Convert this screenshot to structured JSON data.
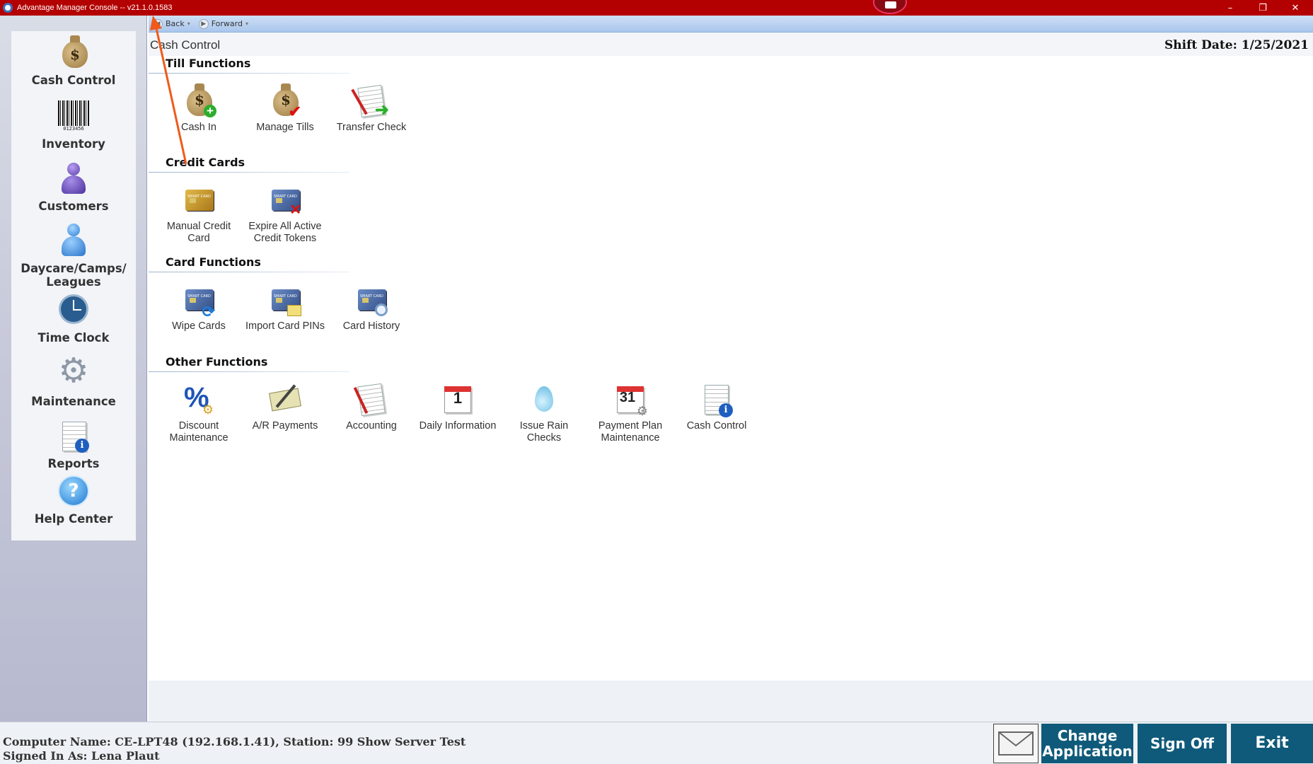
{
  "window": {
    "title": "Advantage Manager Console -- v21.1.0.1583",
    "controls": {
      "minimize": "–",
      "restore": "❐",
      "close": "✕"
    }
  },
  "navbar": {
    "back": "Back",
    "forward": "Forward"
  },
  "sidebar": {
    "items": [
      {
        "label": "Cash Control",
        "icon": "money-bag-icon"
      },
      {
        "label": "Inventory",
        "icon": "barcode-icon"
      },
      {
        "label": "Customers",
        "icon": "person-icon"
      },
      {
        "label": "Daycare/Camps/ Leagues",
        "icon": "person-blue-icon"
      },
      {
        "label": "Time Clock",
        "icon": "clock-icon"
      },
      {
        "label": "Maintenance",
        "icon": "gear-icon"
      },
      {
        "label": "Reports",
        "icon": "report-icon"
      },
      {
        "label": "Help Center",
        "icon": "help-icon"
      }
    ]
  },
  "main": {
    "page_title": "Cash Control",
    "shift_date": "Shift Date: 1/25/2021",
    "sections": [
      {
        "title": "Till Functions",
        "tiles": [
          {
            "label": "Cash In",
            "icon": "cash-in-icon"
          },
          {
            "label": "Manage Tills",
            "icon": "manage-tills-icon"
          },
          {
            "label": "Transfer Check",
            "icon": "transfer-check-icon"
          }
        ]
      },
      {
        "title": "Credit Cards",
        "tiles": [
          {
            "label": "Manual Credit Card",
            "icon": "credit-card-icon"
          },
          {
            "label": "Expire All Active Credit Tokens",
            "icon": "expire-card-icon"
          }
        ]
      },
      {
        "title": "Card Functions",
        "tiles": [
          {
            "label": "Wipe Cards",
            "icon": "wipe-card-icon"
          },
          {
            "label": "Import Card PINs",
            "icon": "import-pins-icon"
          },
          {
            "label": "Card History",
            "icon": "card-history-icon"
          }
        ]
      },
      {
        "title": "Other Functions",
        "tiles": [
          {
            "label": "Discount Maintenance",
            "icon": "percent-icon"
          },
          {
            "label": "A/R Payments",
            "icon": "check-pen-icon"
          },
          {
            "label": "Accounting",
            "icon": "accounting-icon"
          },
          {
            "label": "Daily Information",
            "icon": "calendar-1-icon"
          },
          {
            "label": "Issue Rain Checks",
            "icon": "raindrop-icon"
          },
          {
            "label": "Payment Plan Maintenance",
            "icon": "calendar-31-icon"
          },
          {
            "label": "Cash Control",
            "icon": "cash-control-report-icon"
          }
        ]
      }
    ]
  },
  "status": {
    "computer": "Computer Name: CE-LPT48 (192.168.1.41), Station: 99 Show Server Test",
    "signed_in": "Signed In As: Lena Plaut"
  },
  "buttons": {
    "change_application": "Change Application",
    "sign_off": "Sign Off",
    "exit": "Exit"
  },
  "colors": {
    "titlebar": "#b30000",
    "action_button": "#0f5a7a",
    "annotation_arrow": "#f05a1a"
  }
}
